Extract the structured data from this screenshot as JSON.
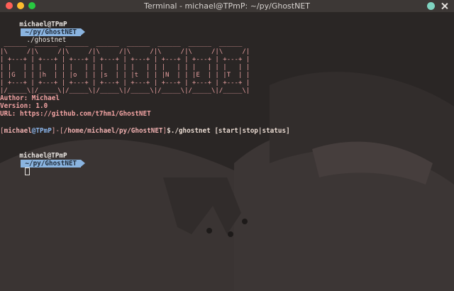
{
  "window": {
    "title": "Terminal - michael@TPmP: ~/py/GhostNET"
  },
  "prompt1": {
    "user": "michael@TPmP",
    "path": "~/py/GhostNET",
    "command": "./ghostnet"
  },
  "banner": {
    "ascii": " ______  ______  ______  ______  ______  ______  ______  ______\n|\\     /|\\     /|\\     /|\\     /|\\     /|\\     /|\\     /|\\     /|\n| +---+ | +---+ | +---+ | +---+ | +---+ | +---+ | +---+ | +---+ |\n| |   | | |   | | |   | | |   | | |   | | |   | | |   | | |   | |\n| |G  | | |h  | | |o  | | |s  | | |t  | | |N  | | |E  | | |T  | |\n| +---+ | +---+ | +---+ | +---+ | +---+ | +---+ | +---+ | +---+ |\n|/_____\\|/_____\\|/_____\\|/_____\\|/_____\\|/_____\\|/_____\\|/_____\\|",
    "author": "Author: Michael",
    "version": "Version: 1.0",
    "url": "URL: https://github.com/t7hm1/GhostNET"
  },
  "ghost_prompt": {
    "open": "[",
    "user": "michael",
    "at": "@",
    "host": "TPmP",
    "sep": "]-[",
    "path": "/home/michael/py/GhostNET",
    "close": "]",
    "dollar": "$",
    "command": "./ghostnet [start|stop|status]"
  },
  "prompt2": {
    "user": "michael@TPmP",
    "path": "~/py/GhostNET"
  },
  "colors": {
    "path_pill": "#8ab4e0",
    "banner": "#e8a0a0",
    "titlebar": "#3d3836"
  }
}
